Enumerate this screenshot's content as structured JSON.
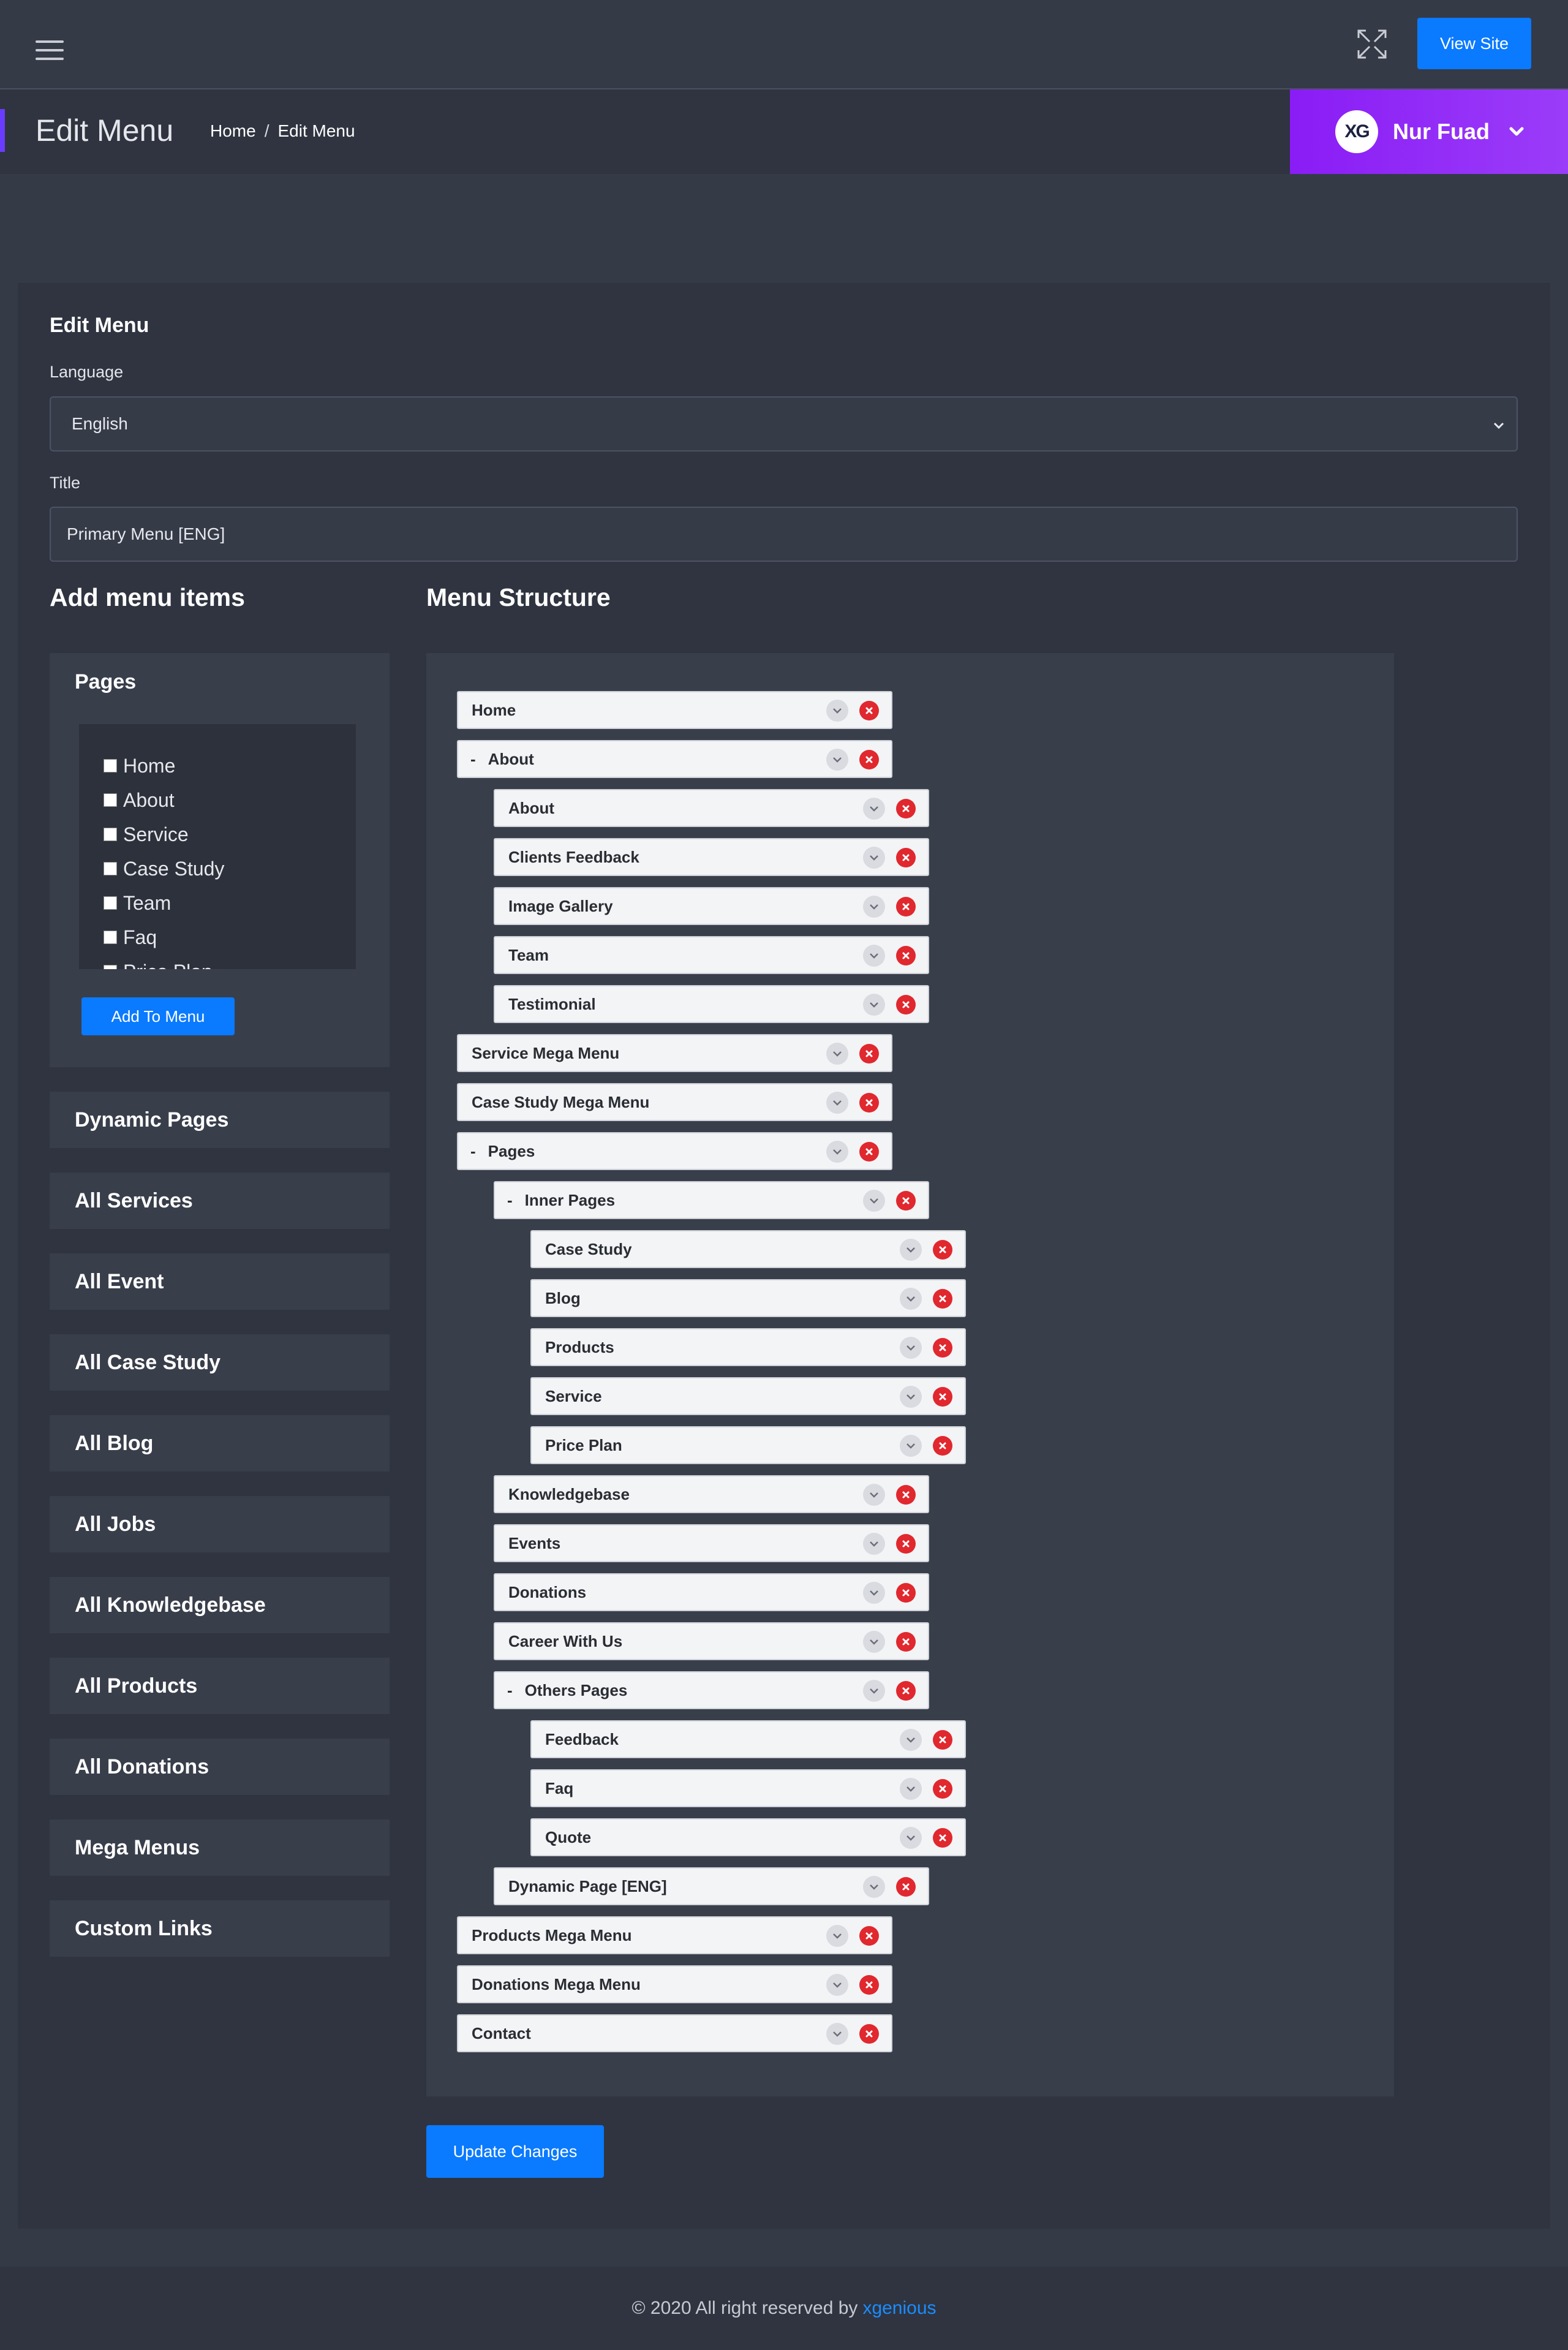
{
  "header": {
    "view_site_label": "View Site",
    "page_title": "Edit Menu",
    "breadcrumb": {
      "home": "Home",
      "separator": "/",
      "current": "Edit Menu"
    },
    "user": {
      "avatar_text": "XG",
      "name": "Nur Fuad"
    }
  },
  "form": {
    "card_title": "Edit Menu",
    "language_label": "Language",
    "language_value": "English",
    "title_label": "Title",
    "title_value": "Primary Menu [ENG]"
  },
  "add_menu": {
    "heading": "Add menu items",
    "pages_title": "Pages",
    "pages": [
      "Home",
      "About",
      "Service",
      "Case Study",
      "Team",
      "Faq",
      "Price Plan"
    ],
    "add_button": "Add To Menu",
    "sections": [
      "Dynamic Pages",
      "All Services",
      "All Event",
      "All Case Study",
      "All Blog",
      "All Jobs",
      "All Knowledgebase",
      "All Products",
      "All Donations",
      "Mega Menus",
      "Custom Links"
    ]
  },
  "menu_structure": {
    "heading": "Menu Structure",
    "items": [
      {
        "label": "Home",
        "depth": 0,
        "has_children": false
      },
      {
        "label": "About",
        "depth": 0,
        "has_children": true
      },
      {
        "label": "About",
        "depth": 1,
        "has_children": false
      },
      {
        "label": "Clients Feedback",
        "depth": 1,
        "has_children": false
      },
      {
        "label": "Image Gallery",
        "depth": 1,
        "has_children": false
      },
      {
        "label": "Team",
        "depth": 1,
        "has_children": false
      },
      {
        "label": "Testimonial",
        "depth": 1,
        "has_children": false
      },
      {
        "label": "Service Mega Menu",
        "depth": 0,
        "has_children": false
      },
      {
        "label": "Case Study Mega Menu",
        "depth": 0,
        "has_children": false
      },
      {
        "label": "Pages",
        "depth": 0,
        "has_children": true
      },
      {
        "label": "Inner Pages",
        "depth": 1,
        "has_children": true
      },
      {
        "label": "Case Study",
        "depth": 2,
        "has_children": false
      },
      {
        "label": "Blog",
        "depth": 2,
        "has_children": false
      },
      {
        "label": "Products",
        "depth": 2,
        "has_children": false
      },
      {
        "label": "Service",
        "depth": 2,
        "has_children": false
      },
      {
        "label": "Price Plan",
        "depth": 2,
        "has_children": false
      },
      {
        "label": "Knowledgebase",
        "depth": 1,
        "has_children": false
      },
      {
        "label": "Events",
        "depth": 1,
        "has_children": false
      },
      {
        "label": "Donations",
        "depth": 1,
        "has_children": false
      },
      {
        "label": "Career With Us",
        "depth": 1,
        "has_children": false
      },
      {
        "label": "Others Pages",
        "depth": 1,
        "has_children": true
      },
      {
        "label": "Feedback",
        "depth": 2,
        "has_children": false
      },
      {
        "label": "Faq",
        "depth": 2,
        "has_children": false
      },
      {
        "label": "Quote",
        "depth": 2,
        "has_children": false
      },
      {
        "label": "Dynamic Page [ENG]",
        "depth": 1,
        "has_children": false
      },
      {
        "label": "Products Mega Menu",
        "depth": 0,
        "has_children": false
      },
      {
        "label": "Donations Mega Menu",
        "depth": 0,
        "has_children": false
      },
      {
        "label": "Contact",
        "depth": 0,
        "has_children": false
      }
    ],
    "update_button": "Update Changes"
  },
  "footer": {
    "text": "© 2020 All right reserved by",
    "link": "xgenious"
  },
  "colors": {
    "accent": "#0a7aff",
    "user_gradient": "#8a1cf5",
    "remove": "#e0282e"
  },
  "icons": [
    "hamburger-icon",
    "fullscreen-icon",
    "chevron-down-icon",
    "remove-icon"
  ]
}
